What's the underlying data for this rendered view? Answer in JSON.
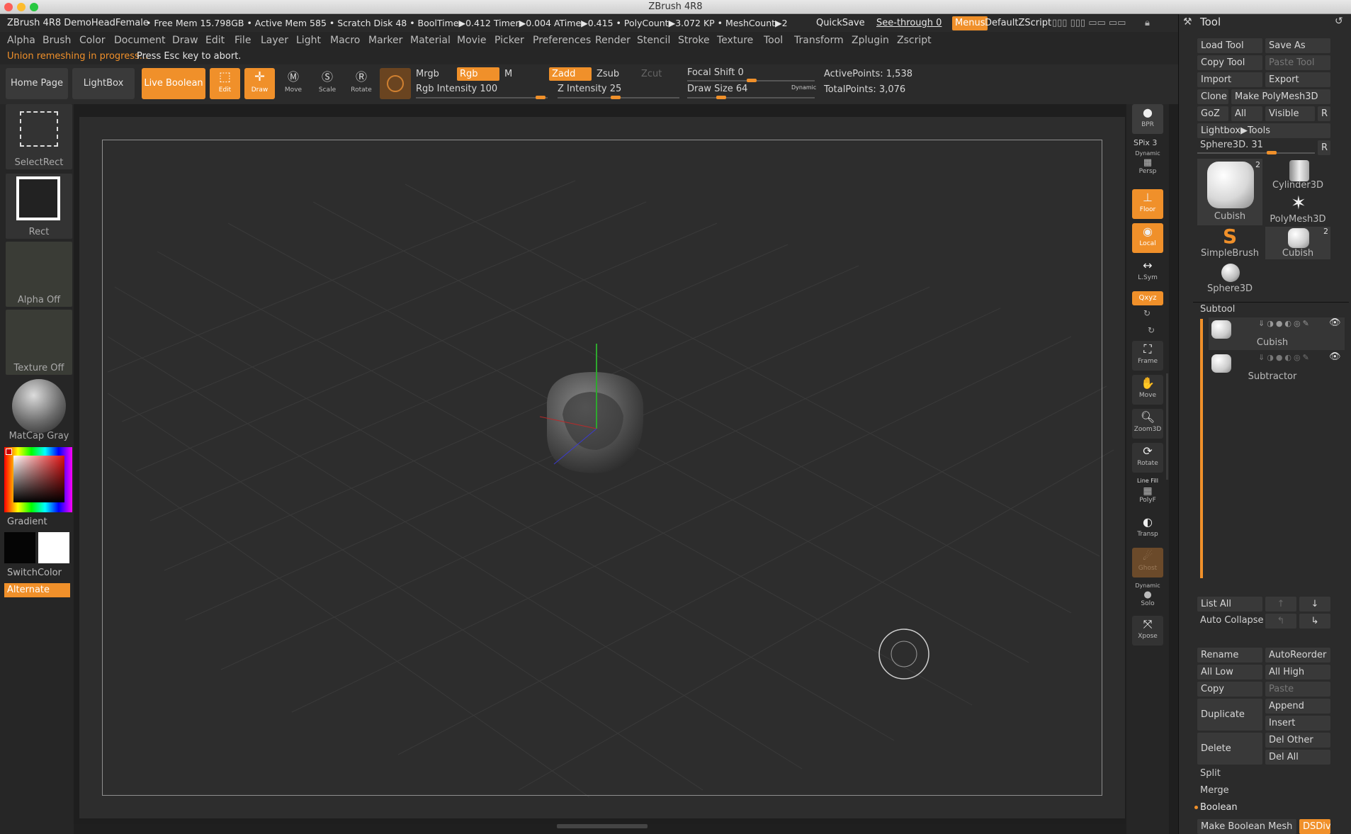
{
  "titlebar": {
    "title": "ZBrush 4R8"
  },
  "info": {
    "doc": "ZBrush 4R8 DemoHeadFemale",
    "stats": "• Free Mem 15.798GB • Active Mem 585 • Scratch Disk 48 • BoolTime▶0.412 Timer▶0.004 ATime▶0.415 • PolyCount▶3.072 KP • MeshCount▶2",
    "quicksave": "QuickSave",
    "seethrough": "See-through  0",
    "menus": "Menus",
    "zscript": "DefaultZScript",
    "tool_header": "Tool"
  },
  "menu": [
    "Alpha",
    "Brush",
    "Color",
    "Document",
    "Draw",
    "Edit",
    "File",
    "Layer",
    "Light",
    "Macro",
    "Marker",
    "Material",
    "Movie",
    "Picker",
    "Preferences",
    "Render",
    "Stencil",
    "Stroke",
    "Texture",
    "Tool",
    "Transform",
    "Zplugin",
    "Zscript"
  ],
  "notice": {
    "status": "Union remeshing in progress...",
    "hint": "Press Esc key to abort."
  },
  "shelf": {
    "home": "Home Page",
    "lightbox": "LightBox",
    "liveboolean": "Live Boolean",
    "edit": "Edit",
    "draw": "Draw",
    "move": "Move",
    "scale": "Scale",
    "rotate": "Rotate",
    "mrgb": "Mrgb",
    "rgb": "Rgb",
    "m": "M",
    "zadd": "Zadd",
    "zsub": "Zsub",
    "zcut": "Zcut",
    "rgb_intensity": "Rgb Intensity 100",
    "z_intensity": "Z Intensity 25",
    "focal_shift": "Focal Shift 0",
    "draw_size": "Draw Size 64",
    "dynamic": "Dynamic",
    "active_points": "ActivePoints: 1,538",
    "total_points": "TotalPoints: 3,076"
  },
  "left": {
    "selectrect": "SelectRect",
    "rect": "Rect",
    "alpha": "Alpha Off",
    "texture": "Texture Off",
    "matcap": "MatCap Gray",
    "gradient": "Gradient",
    "switchcolor": "SwitchColor",
    "alternate": "Alternate"
  },
  "right": {
    "bpr": "BPR",
    "spix": "SPix 3",
    "dynamic": "Dynamic",
    "persp": "Persp",
    "floor": "Floor",
    "local": "Local",
    "lsym": "L.Sym",
    "xyz": "Qxyz",
    "frame": "Frame",
    "move": "Move",
    "zoom3d": "Zoom3D",
    "rotate": "Rotate",
    "linefill": "Line Fill",
    "polyf": "PolyF",
    "transp": "Transp",
    "ghost": "Ghost",
    "dynamic2": "Dynamic",
    "solo": "Solo",
    "xpose": "Xpose"
  },
  "tool": {
    "load": "Load Tool",
    "saveas": "Save As",
    "copy": "Copy Tool",
    "paste": "Paste Tool",
    "import": "Import",
    "export": "Export",
    "clone": "Clone",
    "makepoly": "Make PolyMesh3D",
    "goz": "GoZ",
    "all": "All",
    "visible": "Visible",
    "r": "R",
    "lightbox": "Lightbox▶Tools",
    "sphere_slider": "Sphere3D. 31",
    "thumbs": [
      "Cubish",
      "Cylinder3D",
      "PolyMesh3D",
      "SimpleBrush",
      "Cubish",
      "Sphere3D"
    ],
    "badge": "2",
    "subtool": "Subtool",
    "sub1": "Cubish",
    "sub2": "Subtractor",
    "listall": "List All",
    "autocollapse": "Auto Collapse",
    "rename": "Rename",
    "autoreorder": "AutoReorder",
    "alllow": "All Low",
    "allhigh": "All High",
    "copy2": "Copy",
    "paste2": "Paste",
    "duplicate": "Duplicate",
    "append": "Append",
    "insert": "Insert",
    "delete": "Delete",
    "delother": "Del Other",
    "delall": "Del All",
    "split": "Split",
    "merge": "Merge",
    "boolean": "Boolean",
    "makebool": "Make Boolean Mesh",
    "dsdiv": "DSDiv"
  }
}
